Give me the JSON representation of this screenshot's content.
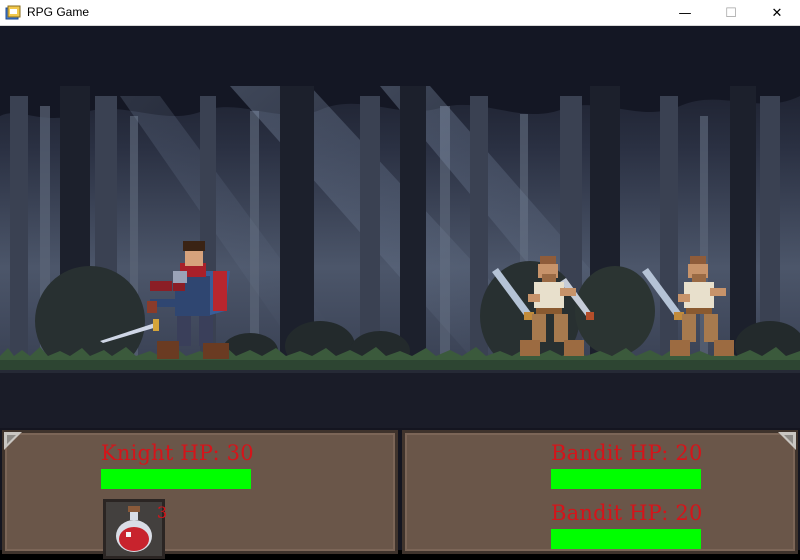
{
  "window": {
    "title": "RPG Game",
    "icon": "game-window-icon",
    "controls": {
      "minimize": "—",
      "maximize": "☐",
      "close": "✕"
    }
  },
  "scene": {
    "setting": "night-forest",
    "colors": {
      "sky": "#161a2b",
      "trees_far": "#3a4253",
      "trees_mid": "#2b3140",
      "trees_near": "#1b1f2b",
      "ground": "#1a1c28",
      "grass": "#2f4a36"
    },
    "characters": [
      {
        "role": "player",
        "name": "Knight"
      },
      {
        "role": "enemy",
        "name": "Bandit"
      },
      {
        "role": "enemy",
        "name": "Bandit"
      }
    ]
  },
  "hud": {
    "player": {
      "label": "Knight HP: 30",
      "hp_fraction": 1.0
    },
    "enemies": [
      {
        "label": "Bandit HP: 20",
        "hp_fraction": 1.0
      },
      {
        "label": "Bandit HP: 20",
        "hp_fraction": 1.0
      }
    ],
    "inventory": {
      "item": "health-potion",
      "count": "3"
    },
    "colors": {
      "panel": "#6a5649",
      "hp_text": "#d5141a",
      "hp_bar": "#00ff00"
    }
  }
}
